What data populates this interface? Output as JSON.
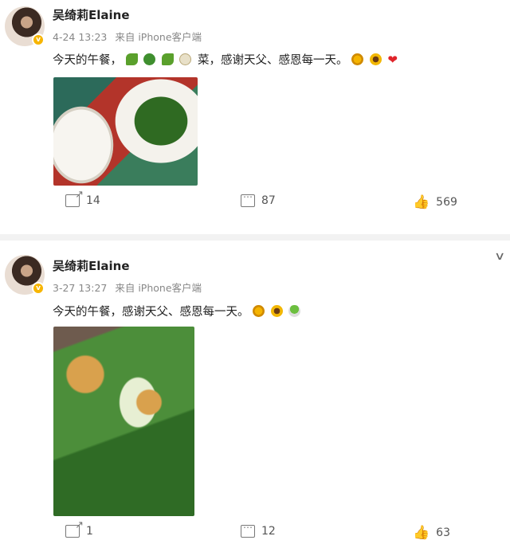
{
  "post1": {
    "username": "吴绮莉Elaine",
    "time": "4-24 13:23",
    "source": "来自 iPhone客户端",
    "text_start": "今天的午餐，",
    "text_end": "菜，感谢天父、感恩每一天。",
    "emoji_icons": [
      "cucumber-icon",
      "broccoli-icon",
      "cucumber-icon",
      "onion-icon",
      "sun-icon",
      "sunflower-icon",
      "heart-icon"
    ],
    "heart": "❤",
    "reposts": "14",
    "comments": "87",
    "likes": "569"
  },
  "post2": {
    "username": "吴绮莉Elaine",
    "time": "3-27 13:27",
    "source": "来自 iPhone客户端",
    "text": "今天的午餐，感谢天父、感恩每一天。",
    "emoji_icons": [
      "sun-icon",
      "sunflower-icon",
      "salad-icon"
    ],
    "reposts": "1",
    "comments": "12",
    "likes": "63",
    "menu_chevron": "∨"
  },
  "colors": {
    "verified": "#f7b500",
    "text": "#222222",
    "meta": "#888888",
    "heart": "#e0242a"
  }
}
